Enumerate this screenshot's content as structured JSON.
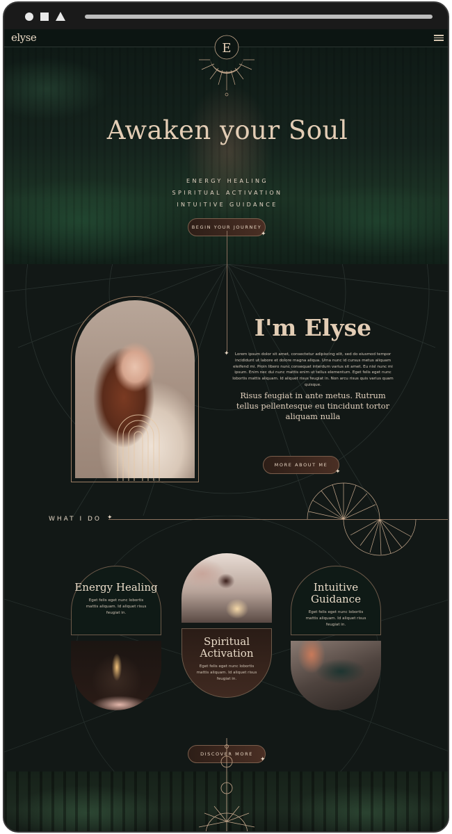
{
  "site": {
    "logo": "elyse"
  },
  "hero": {
    "title": "Awaken your Soul",
    "services": [
      "ENERGY HEALING",
      "SPIRITUAL ACTIVATION",
      "INTUITIVE GUIDANCE"
    ],
    "cta_label": "BEGIN YOUR JOURNEY",
    "emblem_letter": "E"
  },
  "about": {
    "title": "I'm Elyse",
    "body": "Lorem ipsum dolor sit amet, consectetur adipiscing elit, sed do eiusmod tempor incididunt ut labore et dolore magna aliqua. Urna nunc id cursus metus aliquam eleifend mi. Proin libero nunc consequat interdum varius sit amet. Eu nisl nunc mi ipsum. Enim nec dui nunc mattis enim ut tellus elementum. Eget felis eget nunc lobortis mattis aliquam. Id aliquet risus feugiat in. Non arcu risus quis varius quam quisque.",
    "quote": "Risus feugiat in ante metus. Rutrum tellus pellentesque eu tincidunt tortor aliquam nulla",
    "cta_label": "MORE ABOUT ME"
  },
  "services": {
    "section_label": "WHAT I DO",
    "cards": [
      {
        "title": "Energy Healing",
        "text": "Eget felis eget nunc lobortis mattis aliquam. Id aliquet risus feugiat in."
      },
      {
        "title": "Spiritual Activation",
        "text": "Eget felis eget nunc lobortis mattis aliquam. Id aliquet risus feugiat in."
      },
      {
        "title": "Intuitive Guidance",
        "text": "Eget felis eget nunc lobortis mattis aliquam. Id aliquet risus feugiat in."
      }
    ],
    "cta_label": "DISCOVER MORE"
  },
  "colors": {
    "accent_gold": "#e3cdb5",
    "button_brown": "#4a2f24",
    "forest_green": "#1c3325",
    "background": "#121816"
  },
  "icons": [
    "menu-icon",
    "sparkle-icon",
    "moon-sun-emblem-icon",
    "sunburst-icon"
  ]
}
